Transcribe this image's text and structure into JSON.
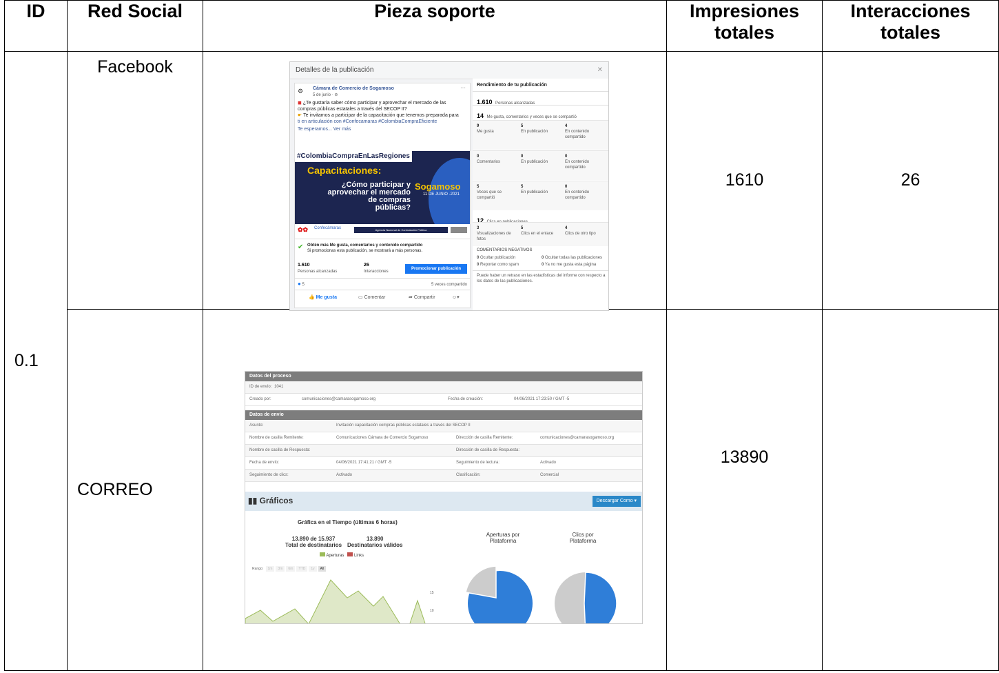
{
  "table": {
    "headers": {
      "id": "ID",
      "red_social": "Red Social",
      "pieza": "Pieza soporte",
      "impresiones": [
        "Impresiones",
        "totales"
      ],
      "interacciones": [
        "Interacciones",
        "totales"
      ]
    },
    "row_id": "0.1",
    "rows": [
      {
        "red": "Facebook",
        "impresiones": "1610",
        "interacciones": "26"
      },
      {
        "red": "CORREO",
        "impresiones": "13890",
        "interacciones": ""
      }
    ]
  },
  "facebook_shot": {
    "title": "Detalles de la publicación",
    "page_name": "Cámara de Comercio de Sogamoso",
    "date": "5 de junio · ",
    "post_lines": [
      "¿Te gustaría saber cómo participar y aprovechar el mercado de las",
      "compras públicas estatales a través del SECOP II?",
      "Te invitamos a participar de la capacitación que tenemos preparada para",
      "ti en articulación con #Confecamaras #ColombiaCompraEficiente",
      "Te esperamos... Ver más"
    ],
    "banner": {
      "hashtag": "#ColombiaCompraEnLasRegiones",
      "heading": "Capacitaciones:",
      "question": [
        "¿Cómo participar y",
        "aprovechar el mercado",
        "de compras",
        "públicas?"
      ],
      "city": "Sogamoso",
      "date": "11 DE JUNIO -2021",
      "agency": "Agencia Nacional de Contratación Pública",
      "logo": "Confecámaras"
    },
    "promo_title": "Obtén más Me gusta, comentarios y contenido compartido",
    "promo_sub": "Si promocionas esta publicación, se mostrará a más personas.",
    "reach_value": "1.610",
    "reach_label": "Personas alcanzadas",
    "interactions_value": "26",
    "interactions_label": "Interacciones",
    "promote_button": "Promocionar publicación",
    "reactions_count": "5",
    "shares": "5 veces compartido",
    "actions": [
      "Me gusta",
      "Comentar",
      "Compartir"
    ],
    "perf_title": "Rendimiento de tu publicación",
    "perf_reach_value": "1.610",
    "perf_reach_label": "Personas alcanzadas",
    "perf_engagement_value": "14",
    "perf_engagement_label": "Me gusta, comentarios y veces que se compartió",
    "grid": [
      [
        {
          "v": "9",
          "l": "Me gusta"
        },
        {
          "v": "5",
          "l": "En publicación"
        },
        {
          "v": "4",
          "l": "En contenido compartido"
        }
      ],
      [
        {
          "v": "0",
          "l": "Comentarios"
        },
        {
          "v": "0",
          "l": "En publicación"
        },
        {
          "v": "0",
          "l": "En contenido compartido"
        }
      ],
      [
        {
          "v": "5",
          "l": "Veces que se compartió"
        },
        {
          "v": "5",
          "l": "En publicación"
        },
        {
          "v": "0",
          "l": "En contenido compartido"
        }
      ]
    ],
    "clicks_value": "12",
    "clicks_label": "Clics en publicaciones",
    "clicks_grid": [
      {
        "v": "3",
        "l": "Visualizaciones de fotos"
      },
      {
        "v": "5",
        "l": "Clics en el enlace"
      },
      {
        "v": "4",
        "l": "Clics de otro tipo"
      }
    ],
    "neg_title": "COMENTARIOS NEGATIVOS",
    "neg": [
      {
        "v": "0",
        "l": "Ocultar publicación"
      },
      {
        "v": "0",
        "l": "Ocultar todas las publicaciones"
      },
      {
        "v": "0",
        "l": "Reportar como spam"
      },
      {
        "v": "0",
        "l": "Ya no me gusta esta página"
      }
    ],
    "footnote": "Puede haber un retraso en las estadísticas del informe con respecto a los datos de las publicaciones."
  },
  "email_shot": {
    "section1": "Datos del proceso",
    "id_label": "ID de envío:",
    "id_value": "1041",
    "creator_label": "Creado por:",
    "creator_value": "comunicaciones@camarasogamoso.org",
    "created_label": "Fecha de creación:",
    "created_value": "04/06/2021 17:23:50 / GMT -5",
    "section2": "Datos de envío",
    "subject_label": "Asunto:",
    "subject_value": "Invitación capacitación compras públicas estatales a través del SECOP II",
    "sender_name_label": "Nombre de casilla Remitente:",
    "sender_name_value": "Comunicaciones Cámara de Comercio Sogamoso",
    "sender_addr_label": "Dirección de casilla Remitente:",
    "sender_addr_value": "comunicaciones@camarasogamoso.org",
    "reply_name_label": "Nombre de casilla de Respuesta:",
    "reply_addr_label": "Dirección de casilla de Respuesta:",
    "sent_label": "Fecha de envío:",
    "sent_value": "04/06/2021 17:41:21 / GMT -5",
    "read_label": "Seguimiento de lectura:",
    "read_value": "Activado",
    "click_label": "Seguimiento de clics:",
    "click_value": "Activado",
    "class_label": "Clasificación:",
    "class_value": "Comercial",
    "charts_title": "Gráficos",
    "download_button": "Descargar Como",
    "time_chart_title": "Gráfica en el Tiempo (últimas 6 horas)",
    "total_value": "13.890 de 15.937",
    "total_label": "Total de destinatarios",
    "valid_value": "13.890",
    "valid_label": "Destinatarios válidos",
    "legend": [
      "Aperturas",
      "Links"
    ],
    "range_label": "Rango:",
    "range_options": [
      "1m",
      "3m",
      "6m",
      "YTD",
      "1y",
      "All"
    ],
    "y_ticks": [
      "15",
      "10"
    ],
    "opens_title": [
      "Aperturas por",
      "Plataforma"
    ],
    "clicks_title": [
      "Clics por",
      "Plataforma"
    ],
    "colors": {
      "green": "#9bbb59",
      "red": "#c0504d",
      "blue": "#2f7ed8",
      "grey": "#cccccc"
    }
  }
}
